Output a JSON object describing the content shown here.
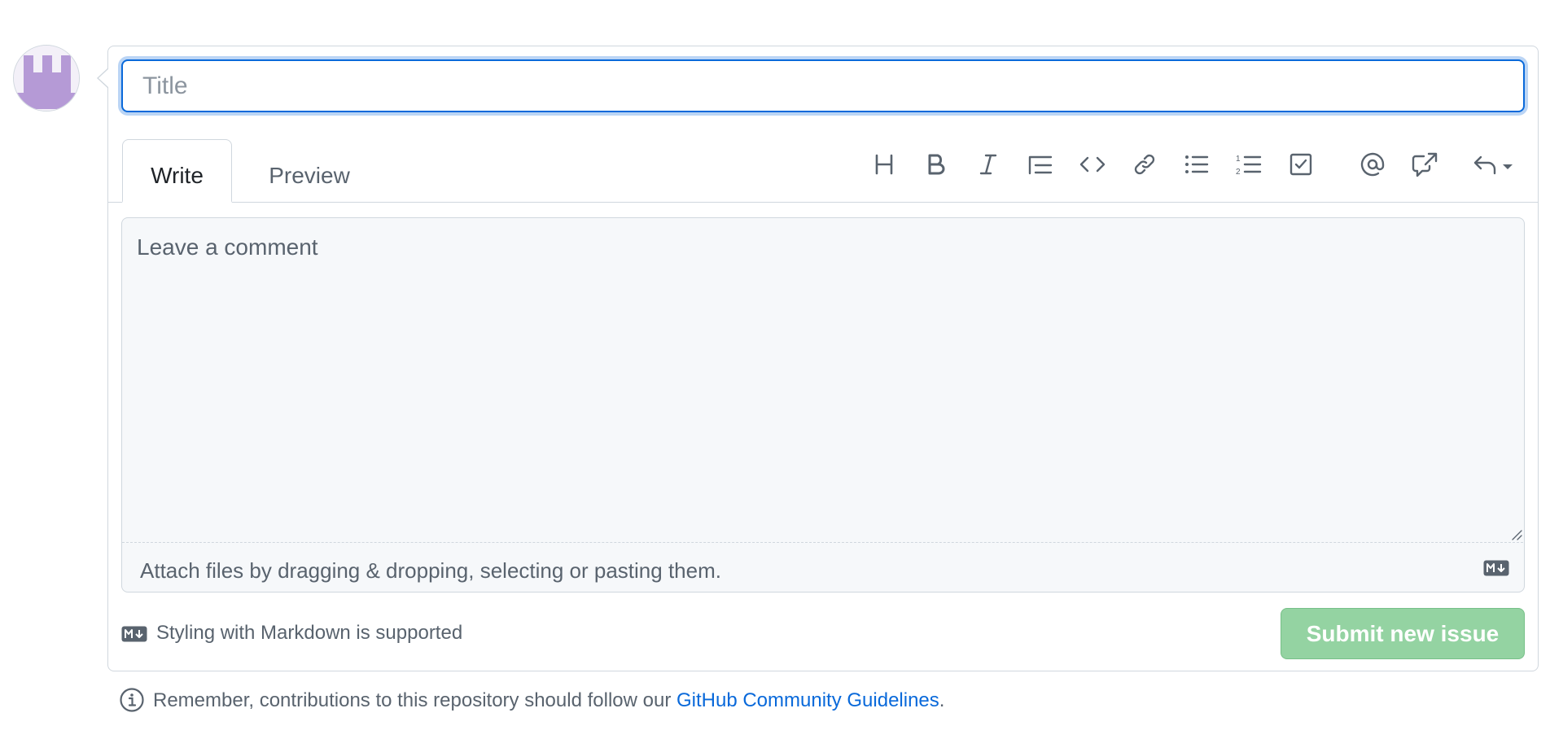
{
  "form": {
    "title_placeholder": "Title",
    "tabs": [
      {
        "label": "Write",
        "active": true
      },
      {
        "label": "Preview",
        "active": false
      }
    ],
    "toolbar": [
      {
        "icon": "heading-icon"
      },
      {
        "icon": "bold-icon"
      },
      {
        "icon": "italic-icon"
      },
      {
        "icon": "quote-icon"
      },
      {
        "icon": "code-icon"
      },
      {
        "icon": "link-icon"
      },
      {
        "icon": "unordered-list-icon"
      },
      {
        "icon": "ordered-list-icon"
      },
      {
        "icon": "task-list-icon"
      },
      {
        "icon": "mention-icon"
      },
      {
        "icon": "cross-reference-icon"
      },
      {
        "icon": "reply-icon"
      }
    ],
    "comment_placeholder": "Leave a comment",
    "attach_text": "Attach files by dragging & dropping, selecting or pasting them.",
    "markdown_note": "Styling with Markdown is supported",
    "submit_label": "Submit new issue"
  },
  "guidelines": {
    "prefix": "Remember, contributions to this repository should follow our ",
    "link_text": "GitHub Community Guidelines",
    "suffix": "."
  },
  "colors": {
    "accent": "#0969da",
    "submit_disabled": "#94d3a2",
    "avatar": "#b59ad6",
    "muted_text": "#59636e",
    "border": "#d0d7de"
  }
}
